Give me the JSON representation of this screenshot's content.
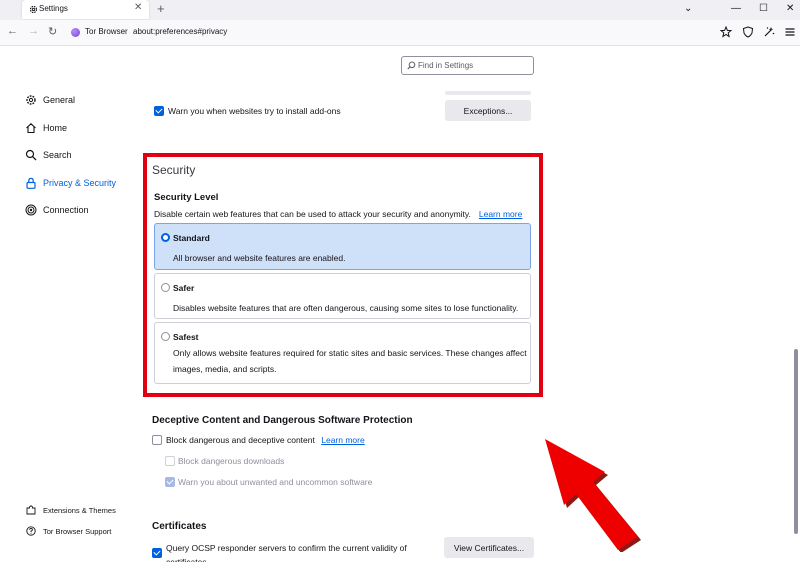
{
  "tab": {
    "title": "Settings",
    "close": "✕",
    "new": "+"
  },
  "window": {
    "minimize": "—",
    "maximize": "☐",
    "close": "✕",
    "list": "⌄"
  },
  "nav": {
    "back": "←",
    "forward": "→",
    "reload": "↻",
    "identity": "Tor Browser",
    "url": "about:preferences#privacy"
  },
  "search": {
    "placeholder": "Find in Settings"
  },
  "sidebar": {
    "items": [
      {
        "label": "General",
        "icon": "gear-icon"
      },
      {
        "label": "Home",
        "icon": "home-icon"
      },
      {
        "label": "Search",
        "icon": "search-icon"
      },
      {
        "label": "Privacy & Security",
        "icon": "lock-icon",
        "selected": true
      },
      {
        "label": "Connection",
        "icon": "connection-icon"
      }
    ],
    "footer": [
      {
        "label": "Extensions & Themes",
        "icon": "puzzle-icon"
      },
      {
        "label": "Tor Browser Support",
        "icon": "help-icon"
      }
    ]
  },
  "addons": {
    "label": "Warn you when websites try to install add-ons",
    "checked": true,
    "exceptions": "Exceptions..."
  },
  "security": {
    "title": "Security",
    "level_title": "Security Level",
    "desc": "Disable certain web features that can be used to attack your security and anonymity.",
    "learn_more": "Learn more",
    "levels": [
      {
        "name": "Standard",
        "text": "All browser and website features are enabled.",
        "selected": true
      },
      {
        "name": "Safer",
        "text": "Disables website features that are often dangerous, causing some sites to lose functionality.",
        "selected": false
      },
      {
        "name": "Safest",
        "text": "Only allows website features required for static sites and basic services. These changes affect images, media, and scripts.",
        "selected": false
      }
    ]
  },
  "deceptive": {
    "title": "Deceptive Content and Dangerous Software Protection",
    "block": "Block dangerous and deceptive content",
    "learn_more": "Learn more",
    "downloads": "Block dangerous downloads",
    "unwanted": "Warn you about unwanted and uncommon software"
  },
  "certificates": {
    "title": "Certificates",
    "ocsp": "Query OCSP responder servers to confirm the current validity of certificates",
    "view": "View Certificates..."
  },
  "colors": {
    "accent": "#0061e0",
    "highlight": "#e0000f",
    "selected_card": "#cfe0f9"
  }
}
